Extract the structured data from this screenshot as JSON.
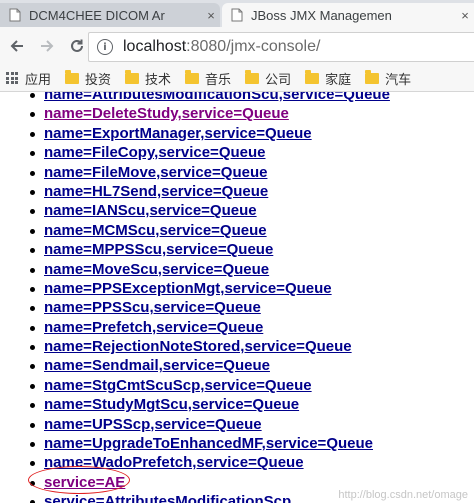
{
  "browser": {
    "tabs": [
      {
        "title": "DCM4CHEE DICOM Ar",
        "close": "×",
        "active": false
      },
      {
        "title": "JBoss JMX Managemen",
        "close": "×",
        "active": true
      }
    ],
    "address": {
      "host": "localhost",
      "rest": ":8080/jmx-console/"
    },
    "bookmarks": [
      {
        "label": "应用",
        "icon": "apps-icon"
      },
      {
        "label": "投资",
        "icon": "folder-icon"
      },
      {
        "label": "技术",
        "icon": "folder-icon"
      },
      {
        "label": "音乐",
        "icon": "folder-icon"
      },
      {
        "label": "公司",
        "icon": "folder-icon"
      },
      {
        "label": "家庭",
        "icon": "folder-icon"
      },
      {
        "label": "汽车",
        "icon": "folder-icon"
      }
    ]
  },
  "mbeans": [
    {
      "label": "name=AttributesModificationScu,service=Queue",
      "style": "normal"
    },
    {
      "label": "name=DeleteStudy,service=Queue",
      "style": "visited"
    },
    {
      "label": "name=ExportManager,service=Queue",
      "style": "normal"
    },
    {
      "label": "name=FileCopy,service=Queue",
      "style": "normal"
    },
    {
      "label": "name=FileMove,service=Queue",
      "style": "normal"
    },
    {
      "label": "name=HL7Send,service=Queue",
      "style": "normal"
    },
    {
      "label": "name=IANScu,service=Queue",
      "style": "normal"
    },
    {
      "label": "name=MCMScu,service=Queue",
      "style": "normal"
    },
    {
      "label": "name=MPPSScu,service=Queue",
      "style": "normal"
    },
    {
      "label": "name=MoveScu,service=Queue",
      "style": "normal"
    },
    {
      "label": "name=PPSExceptionMgt,service=Queue",
      "style": "normal"
    },
    {
      "label": "name=PPSScu,service=Queue",
      "style": "normal"
    },
    {
      "label": "name=Prefetch,service=Queue",
      "style": "normal"
    },
    {
      "label": "name=RejectionNoteStored,service=Queue",
      "style": "normal"
    },
    {
      "label": "name=Sendmail,service=Queue",
      "style": "normal"
    },
    {
      "label": "name=StgCmtScuScp,service=Queue",
      "style": "normal"
    },
    {
      "label": "name=StudyMgtScu,service=Queue",
      "style": "normal"
    },
    {
      "label": "name=UPSScp,service=Queue",
      "style": "normal"
    },
    {
      "label": "name=UpgradeToEnhancedMF,service=Queue",
      "style": "normal"
    },
    {
      "label": "name=WadoPrefetch,service=Queue",
      "style": "normal"
    },
    {
      "label": "service=AE",
      "style": "highlighted"
    },
    {
      "label": "service=AttributesModificationScp",
      "style": "normal"
    }
  ],
  "watermark": "http://blog.csdn.net/omage"
}
